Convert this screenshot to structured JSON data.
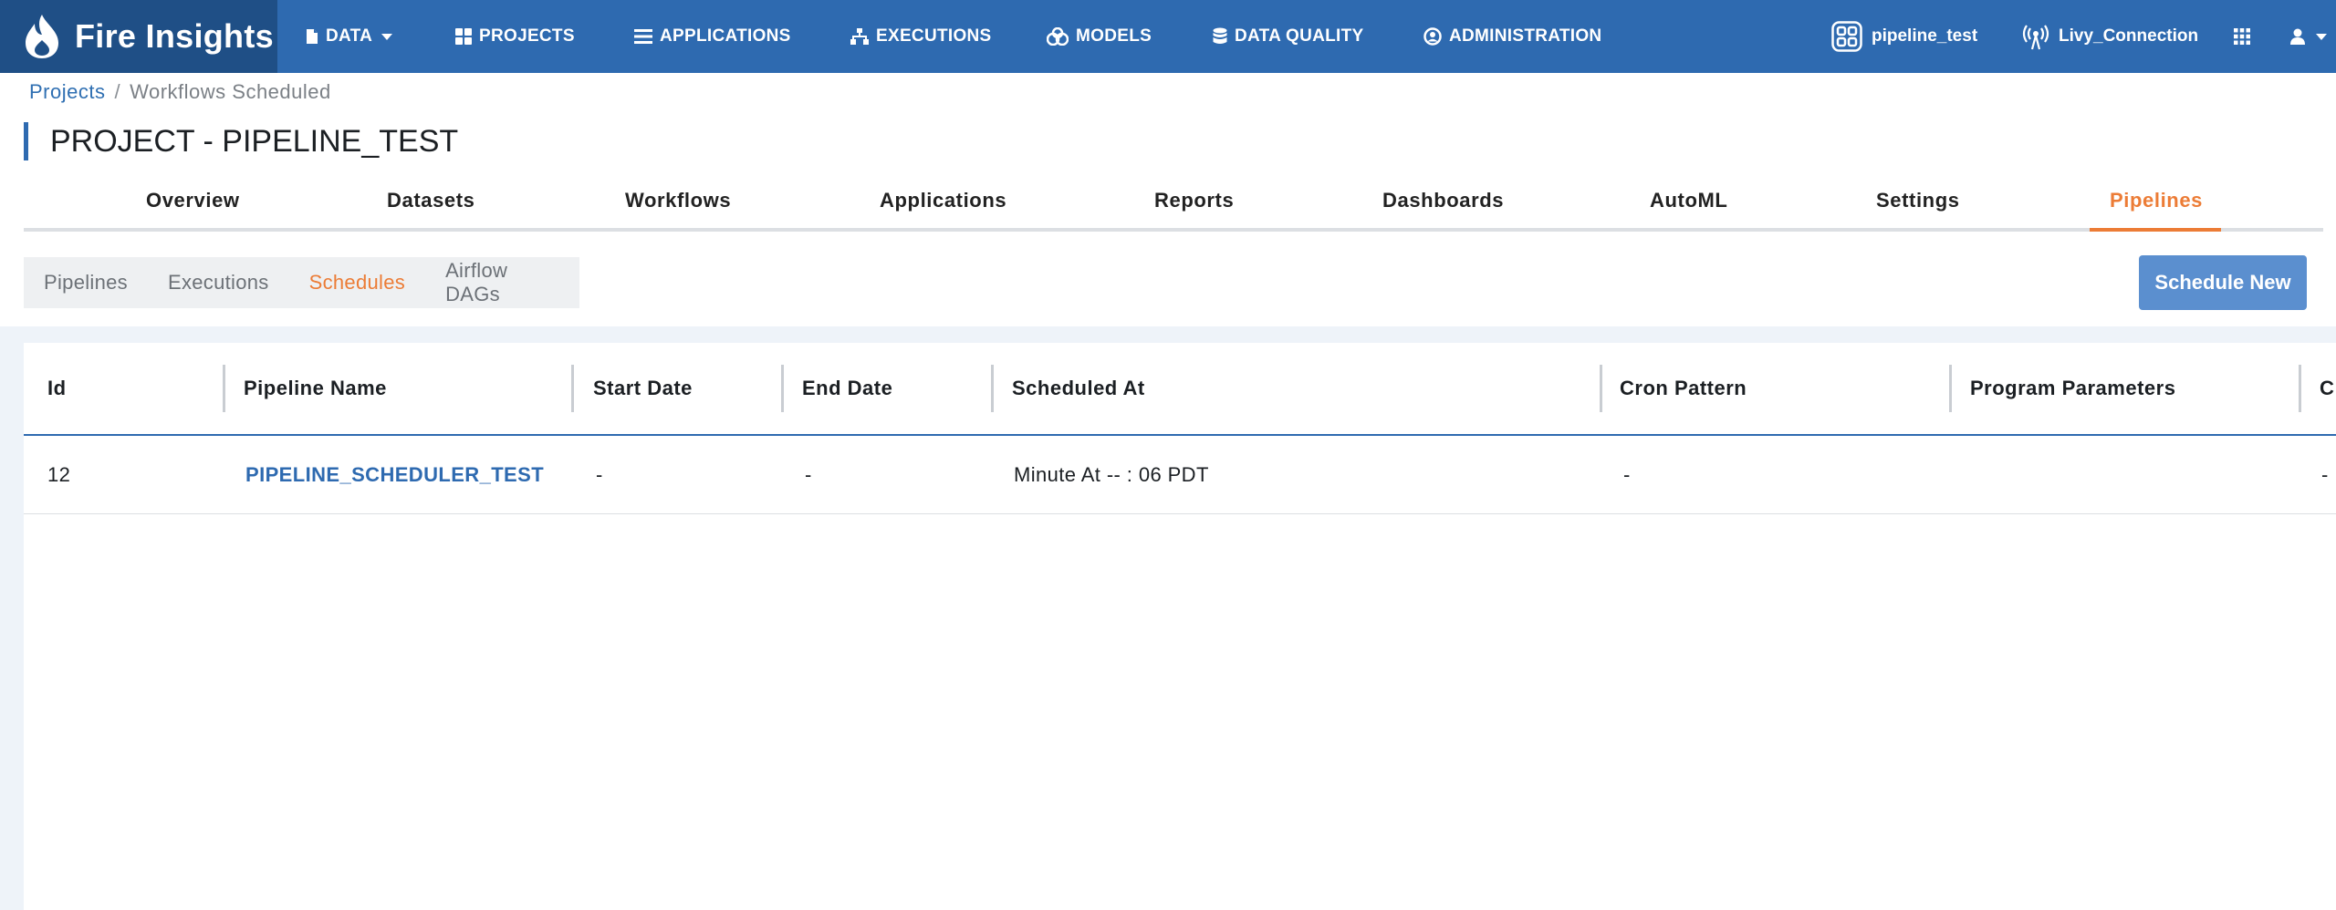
{
  "brand": {
    "name": "Fire Insights"
  },
  "nav": {
    "data": "DATA",
    "projects": "PROJECTS",
    "applications": "APPLICATIONS",
    "executions": "EXECUTIONS",
    "models": "MODELS",
    "data_quality": "DATA QUALITY",
    "administration": "ADMINISTRATION",
    "project_selector": "pipeline_test",
    "connection": "Livy_Connection"
  },
  "breadcrumb": {
    "projects": "Projects",
    "separator": "/",
    "current": "Workflows Scheduled"
  },
  "page_title": "PROJECT - PIPELINE_TEST",
  "tabs": [
    "Overview",
    "Datasets",
    "Workflows",
    "Applications",
    "Reports",
    "Dashboards",
    "AutoML",
    "Settings",
    "Pipelines"
  ],
  "active_tab": "Pipelines",
  "subtabs": [
    "Pipelines",
    "Executions",
    "Schedules",
    "Airflow DAGs"
  ],
  "active_subtab": "Schedules",
  "schedule_button": "Schedule New",
  "table": {
    "columns": [
      "Id",
      "Pipeline Name",
      "Start Date",
      "End Date",
      "Scheduled At",
      "Cron Pattern",
      "Program Parameters",
      "C"
    ],
    "rows": [
      {
        "id": "12",
        "pipeline_name": "PIPELINE_SCHEDULER_TEST",
        "start_date": "-",
        "end_date": "-",
        "scheduled_at": "Minute At -- : 06 PDT",
        "cron_pattern": "-",
        "program_parameters": "",
        "trailing": "-"
      }
    ]
  },
  "colors": {
    "navbar": "#2e6ab0",
    "brand_bg": "#1f4f86",
    "accent": "#ec7c36",
    "button": "#5b8fcf"
  }
}
